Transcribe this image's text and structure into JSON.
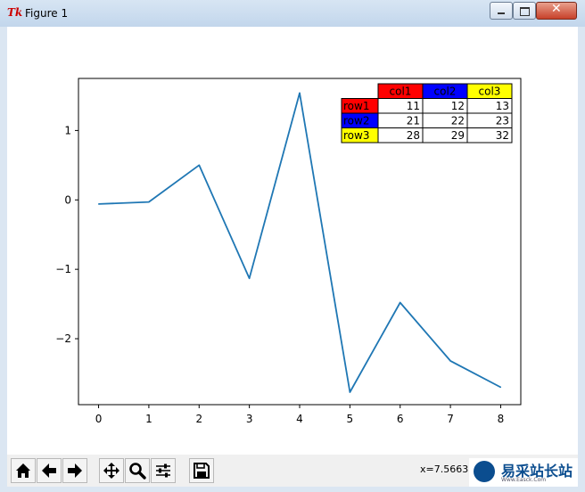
{
  "window": {
    "title": "Figure 1",
    "app_icon": "Tk",
    "controls": [
      "minimize-icon",
      "maximize-icon",
      "close-icon"
    ]
  },
  "toolbar": {
    "buttons": [
      {
        "name": "home",
        "icon": "home-icon"
      },
      {
        "name": "back",
        "icon": "arrow-left-icon"
      },
      {
        "name": "forward",
        "icon": "arrow-right-icon"
      },
      {
        "name": "pan",
        "icon": "move-icon"
      },
      {
        "name": "zoom",
        "icon": "magnifier-icon"
      },
      {
        "name": "configure-subplots",
        "icon": "sliders-icon"
      },
      {
        "name": "save",
        "icon": "floppy-disk-icon"
      }
    ],
    "coordinates": "x=7.5663",
    "watermark": {
      "text": "易采站长站",
      "subtext": "Www.Easck.Com"
    }
  },
  "chart_data": {
    "type": "line",
    "x": [
      0,
      1,
      2,
      3,
      4,
      5,
      6,
      7,
      8
    ],
    "series": [
      {
        "values": [
          -0.06,
          -0.03,
          0.5,
          -1.13,
          1.54,
          -2.77,
          -1.48,
          -2.32,
          -2.7
        ],
        "color": "#1f77b4"
      }
    ],
    "xlim": [
      -0.4,
      8.4
    ],
    "ylim": [
      -2.95,
      1.75
    ],
    "xticks": [
      "0",
      "1",
      "2",
      "3",
      "4",
      "5",
      "6",
      "7",
      "8"
    ],
    "yticks": [
      {
        "value": 1,
        "label": "1"
      },
      {
        "value": 0,
        "label": "0"
      },
      {
        "value": -1,
        "label": "−1"
      },
      {
        "value": -2,
        "label": "−2"
      }
    ],
    "grid": false,
    "table": {
      "location": "top-right",
      "col_labels": [
        "col1",
        "col2",
        "col3"
      ],
      "col_colors": [
        "#ff0000",
        "#0000ff",
        "#ffff00"
      ],
      "row_labels": [
        "row1",
        "row2",
        "row3"
      ],
      "row_colors": [
        "#ff0000",
        "#0000ff",
        "#ffff00"
      ],
      "cells": [
        [
          "11",
          "12",
          "13"
        ],
        [
          "21",
          "22",
          "23"
        ],
        [
          "28",
          "29",
          "32"
        ]
      ]
    }
  }
}
